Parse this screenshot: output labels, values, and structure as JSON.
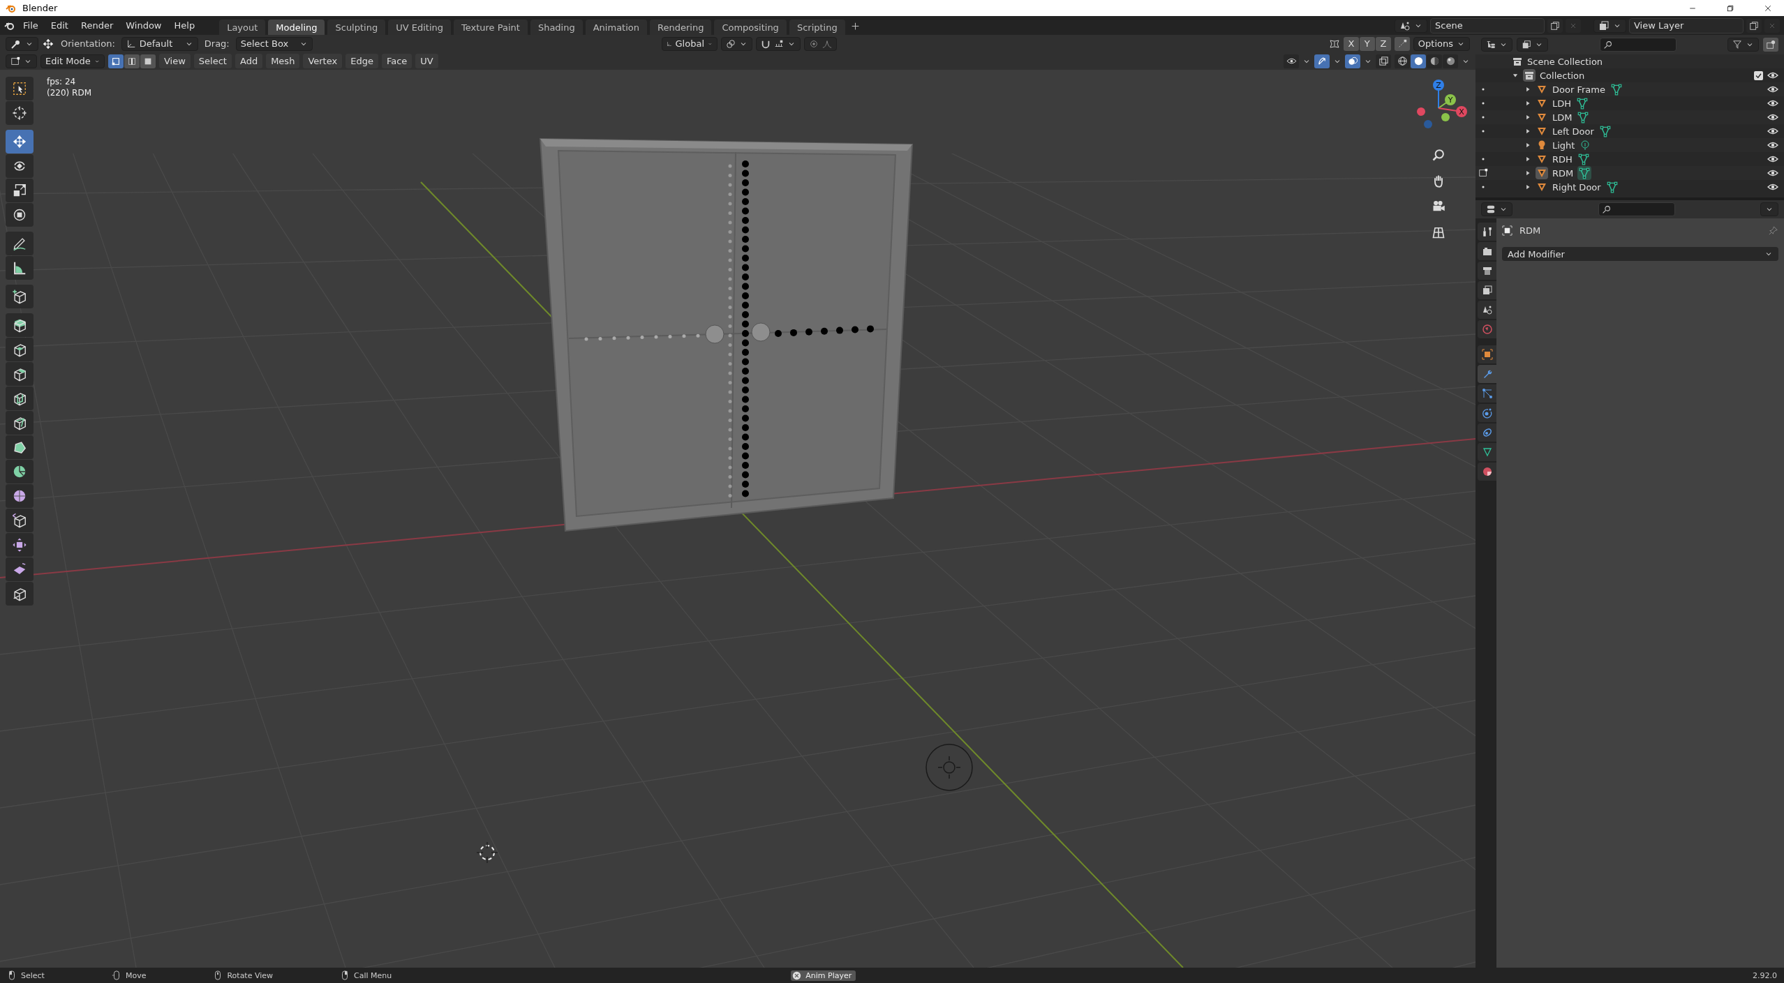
{
  "window": {
    "title": "Blender"
  },
  "menu": [
    "File",
    "Edit",
    "Render",
    "Window",
    "Help"
  ],
  "workspaces": [
    {
      "label": "Layout",
      "selected": false
    },
    {
      "label": "Modeling",
      "selected": true
    },
    {
      "label": "Sculpting",
      "selected": false
    },
    {
      "label": "UV Editing",
      "selected": false
    },
    {
      "label": "Texture Paint",
      "selected": false
    },
    {
      "label": "Shading",
      "selected": false
    },
    {
      "label": "Animation",
      "selected": false
    },
    {
      "label": "Rendering",
      "selected": false
    },
    {
      "label": "Compositing",
      "selected": false
    },
    {
      "label": "Scripting",
      "selected": false
    }
  ],
  "scene": "Scene",
  "view_layer": "View Layer",
  "tool_header": {
    "orientation_label": "Orientation:",
    "orientation": "Default",
    "drag_label": "Drag:",
    "drag": "Select Box",
    "transform_orientation": "Global",
    "proportional_editing": false,
    "axes": [
      "X",
      "Y",
      "Z"
    ],
    "options": "Options"
  },
  "viewport_header": {
    "mode": "Edit Mode",
    "select_modes": [
      {
        "kind": "vertex",
        "selected": true
      },
      {
        "kind": "edge",
        "selected": false
      },
      {
        "kind": "face",
        "selected": false
      }
    ],
    "menus": [
      "View",
      "Select",
      "Add",
      "Mesh",
      "Vertex",
      "Edge",
      "Face",
      "UV"
    ],
    "toggles": [
      {
        "kind": "visibility",
        "on": false
      },
      {
        "kind": "gizmo",
        "on": true
      },
      {
        "kind": "overlay",
        "on": true
      },
      {
        "kind": "xray",
        "on": false
      }
    ],
    "shading": [
      {
        "kind": "wireframe",
        "selected": false
      },
      {
        "kind": "solid",
        "selected": true
      },
      {
        "kind": "material",
        "selected": false
      },
      {
        "kind": "rendered",
        "selected": false
      }
    ]
  },
  "viewport": {
    "fps": "fps: 24",
    "object_info": "(220) RDM",
    "gizmo_axes": [
      "Z",
      "Y",
      "X"
    ]
  },
  "tools": [
    {
      "kind": "select-box",
      "selected": false
    },
    {
      "kind": "cursor",
      "selected": false
    },
    {
      "kind": "move",
      "selected": true
    },
    {
      "kind": "rotate",
      "selected": false
    },
    {
      "kind": "scale",
      "selected": false
    },
    {
      "kind": "transform",
      "selected": false
    },
    {
      "kind": "annotate",
      "selected": false
    },
    {
      "kind": "measure",
      "selected": false
    },
    {
      "kind": "add-cube",
      "selected": false
    },
    {
      "kind": "extrude",
      "selected": false
    },
    {
      "kind": "inset",
      "selected": false
    },
    {
      "kind": "bevel",
      "selected": false
    },
    {
      "kind": "loop-cut",
      "selected": false
    },
    {
      "kind": "knife",
      "selected": false
    },
    {
      "kind": "poly-build",
      "selected": false
    },
    {
      "kind": "spin",
      "selected": false
    },
    {
      "kind": "smooth",
      "selected": false
    },
    {
      "kind": "edge-slide",
      "selected": false
    },
    {
      "kind": "shrink",
      "selected": false
    },
    {
      "kind": "shear",
      "selected": false
    },
    {
      "kind": "rip",
      "selected": false
    }
  ],
  "outliner": {
    "tree": [
      {
        "label": "Scene Collection",
        "kind": "scene-collection",
        "children": [
          {
            "label": "Collection",
            "kind": "collection",
            "expanded": true,
            "checked": true,
            "children": [
              {
                "label": "Door Frame",
                "kind": "mesh",
                "in_edit_mode": false,
                "expanded": false,
                "active": false
              },
              {
                "label": "LDH",
                "kind": "mesh",
                "in_edit_mode": false,
                "expanded": false,
                "active": false
              },
              {
                "label": "LDM",
                "kind": "mesh",
                "in_edit_mode": false,
                "expanded": false,
                "active": false
              },
              {
                "label": "Left Door",
                "kind": "mesh",
                "in_edit_mode": false,
                "expanded": false,
                "active": false
              },
              {
                "label": "Light",
                "kind": "light",
                "expanded": false,
                "active": false
              },
              {
                "label": "RDH",
                "kind": "mesh",
                "in_edit_mode": false,
                "expanded": false,
                "active": false
              },
              {
                "label": "RDM",
                "kind": "mesh",
                "in_edit_mode": true,
                "expanded": false,
                "active": true
              },
              {
                "label": "Right Door",
                "kind": "mesh",
                "in_edit_mode": false,
                "expanded": false,
                "active": false
              }
            ]
          }
        ]
      }
    ]
  },
  "properties": {
    "object_name": "RDM",
    "add_modifier": "Add Modifier",
    "tabs": [
      {
        "kind": "tool",
        "selected": false
      },
      {
        "kind": "render",
        "selected": false
      },
      {
        "kind": "output",
        "selected": false
      },
      {
        "kind": "view-layer",
        "selected": false
      },
      {
        "kind": "scene",
        "selected": false
      },
      {
        "kind": "world",
        "selected": false
      },
      {
        "kind": "object",
        "selected": false
      },
      {
        "kind": "modifiers",
        "selected": true
      },
      {
        "kind": "particles",
        "selected": false
      },
      {
        "kind": "physics",
        "selected": false
      },
      {
        "kind": "constraints",
        "selected": false
      },
      {
        "kind": "data",
        "selected": false
      },
      {
        "kind": "material",
        "selected": false
      }
    ]
  },
  "status_bar": {
    "items": [
      {
        "kind": "mouse-left",
        "label": "Select"
      },
      {
        "kind": "mouse-drag",
        "label": "Move"
      },
      {
        "kind": "mouse-middle",
        "label": "Rotate View"
      },
      {
        "kind": "mouse-right",
        "label": "Call Menu"
      }
    ],
    "notice": "Anim Player",
    "version": "2.92.0"
  }
}
